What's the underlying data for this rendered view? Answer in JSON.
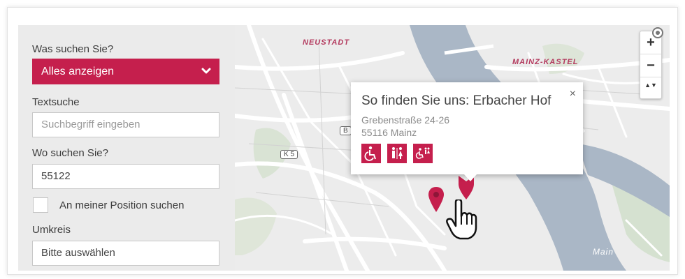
{
  "filter": {
    "what_label": "Was suchen Sie?",
    "category_select": "Alles anzeigen",
    "text_search_label": "Textsuche",
    "text_search_placeholder": "Suchbegriff eingeben",
    "where_label": "Wo suchen Sie?",
    "where_value": "55122",
    "use_position_label": "An meiner Position suchen",
    "radius_label": "Umkreis",
    "radius_value": "Bitte auswählen"
  },
  "map": {
    "labels": {
      "neustadt": "NEUSTADT",
      "mainz_kastel": "MAINZ-KASTEL",
      "k5": "K 5",
      "b": "B",
      "main": "Main"
    },
    "zoom_in": "+",
    "zoom_out": "−",
    "compass": "▲▼"
  },
  "popup": {
    "title": "So finden Sie uns: Erbacher Hof",
    "close": "×",
    "street": "Grebenstraße 24-26",
    "city": "55116 Mainz",
    "icons": [
      "wheelchair-icon",
      "toilets-icon",
      "accessible-toilet-icon"
    ]
  },
  "colors": {
    "accent": "#c51f4d",
    "river": "#aab7c6",
    "panel": "#ebebeb"
  }
}
